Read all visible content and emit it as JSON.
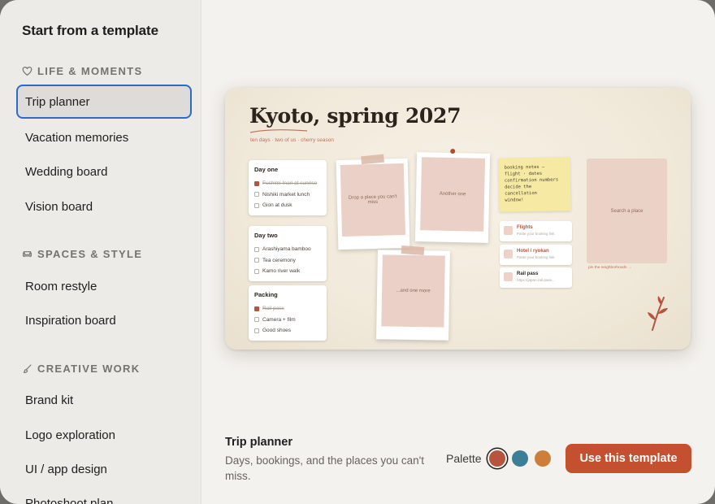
{
  "sidebar": {
    "title": "Start from a template",
    "sections": [
      {
        "label": "LIFE & MOMENTS",
        "icon": "heart-icon",
        "items": [
          "Trip planner",
          "Vacation memories",
          "Wedding board",
          "Vision board"
        ]
      },
      {
        "label": "SPACES & STYLE",
        "icon": "sofa-icon",
        "items": [
          "Room restyle",
          "Inspiration board"
        ]
      },
      {
        "label": "CREATIVE WORK",
        "icon": "brush-icon",
        "items": [
          "Brand kit",
          "Logo exploration",
          "UI / app design",
          "Photoshoot plan"
        ]
      }
    ],
    "selected_item": "Trip planner"
  },
  "preview": {
    "title": "Kyoto, spring 2027",
    "subtitle": "ten days · two of us · cherry season",
    "day_one": {
      "title": "Day one",
      "items": [
        {
          "text": "Fushimi Inari at sunrise",
          "done": true
        },
        {
          "text": "Nishiki market lunch",
          "done": false
        },
        {
          "text": "Gion at dusk",
          "done": false
        }
      ]
    },
    "day_two": {
      "title": "Day two",
      "items": [
        {
          "text": "Arashiyama bamboo",
          "done": false
        },
        {
          "text": "Tea ceremony",
          "done": false
        },
        {
          "text": "Kamo river walk",
          "done": false
        }
      ]
    },
    "packing": {
      "title": "Packing",
      "items": [
        {
          "text": "Rail pass",
          "done": true
        },
        {
          "text": "Camera + film",
          "done": false
        },
        {
          "text": "Good shoes",
          "done": false
        }
      ]
    },
    "photos": {
      "drop_place": "Drop a place you can't miss",
      "another": "Another one",
      "just_one_more": "...and one more"
    },
    "sticky_note": [
      "booking notes —",
      "flight · dates",
      "confirmation numbers",
      "decide the cancellation",
      "window!"
    ],
    "links": [
      {
        "title": "Flights",
        "desc": "Paste your booking link"
      },
      {
        "title": "Hotel / ryokan",
        "desc": "Paste your booking link"
      },
      {
        "title": "Rail pass",
        "desc": "https://japan-rail-pass..."
      }
    ],
    "search_place": "Search a place",
    "neighborhoods_hint": "pin the neighborhoods →"
  },
  "footer": {
    "title": "Trip planner",
    "description": "Days, bookings, and the places you can't miss.",
    "palette_label": "Palette",
    "swatches": [
      "#b5553e",
      "#3b7e96",
      "#cc7f3b"
    ],
    "selected_swatch": 0,
    "cta_label": "Use this template"
  },
  "colors": {
    "accent": "#c4502f",
    "selection_border": "#2f6ac4"
  }
}
